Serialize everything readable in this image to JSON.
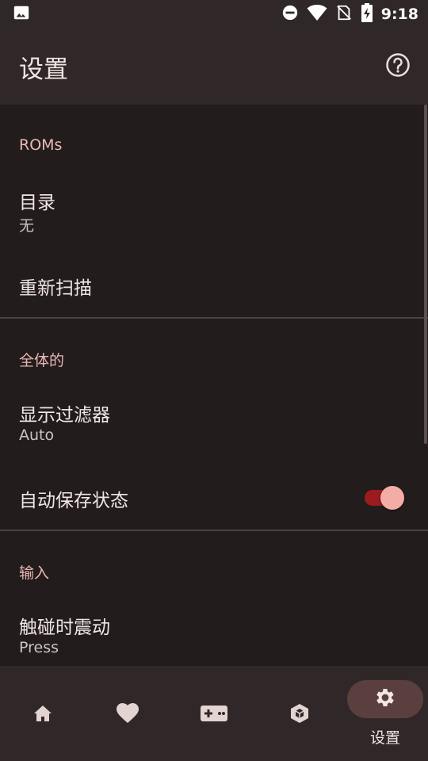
{
  "status_bar": {
    "time": "9:18",
    "icons": [
      "image-icon",
      "dnd-icon",
      "wifi-icon",
      "no-sim-icon",
      "battery-charging-icon"
    ]
  },
  "app_bar": {
    "title": "设置",
    "help_icon": "help-circle-icon"
  },
  "sections": [
    {
      "header": "ROMs",
      "items": [
        {
          "title": "目录",
          "subtitle": "无"
        },
        {
          "title": "重新扫描"
        }
      ]
    },
    {
      "header": "全体的",
      "items": [
        {
          "title": "显示过滤器",
          "subtitle": "Auto"
        },
        {
          "title": "自动保存状态",
          "toggle": true
        }
      ]
    },
    {
      "header": "输入",
      "items": [
        {
          "title": "触碰时震动",
          "subtitle": "Press"
        }
      ]
    }
  ],
  "bottom_nav": {
    "items": [
      {
        "icon": "home-icon",
        "label": ""
      },
      {
        "icon": "heart-icon",
        "label": ""
      },
      {
        "icon": "gamepad-icon",
        "label": ""
      },
      {
        "icon": "cube-icon",
        "label": ""
      },
      {
        "icon": "gear-icon",
        "label": "设置",
        "active": true
      }
    ]
  },
  "colors": {
    "background": "#231c1c",
    "surface": "#302828",
    "accent": "#e8b9b4",
    "toggle_track": "#9b1b1f",
    "toggle_thumb": "#f4aca7",
    "nav_active": "#5b3f3e"
  }
}
